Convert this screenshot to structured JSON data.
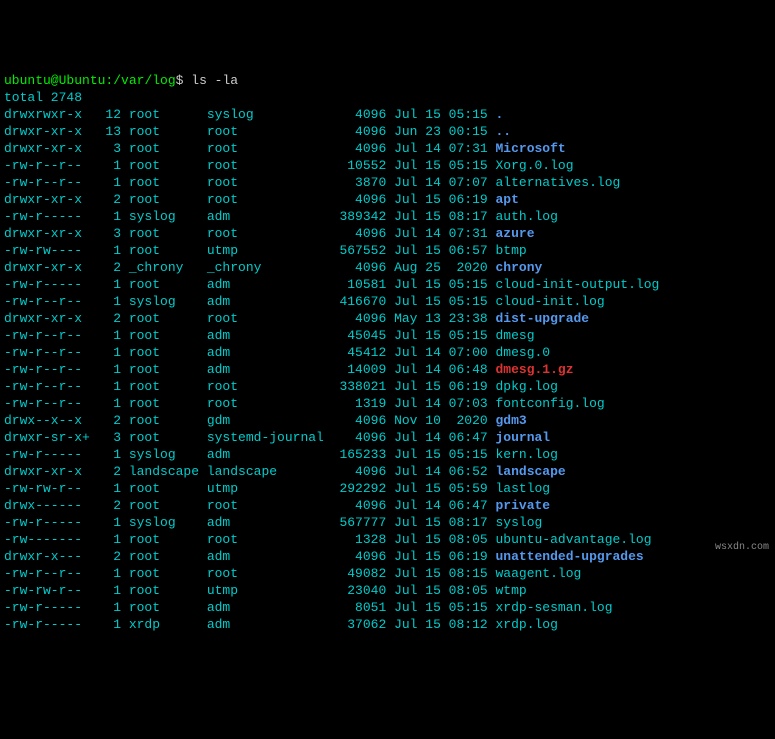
{
  "prompt": {
    "user_host": "ubuntu@Ubuntu",
    "sep": ":",
    "path": "/var/log",
    "dollar": "$",
    "command": "ls -la"
  },
  "total": "total 2748",
  "watermark": "wsxdn.com",
  "rows": [
    {
      "perm": "drwxrwxr-x",
      "links": "12",
      "owner": "root",
      "group": "syslog",
      "size": "4096",
      "date": "Jul 15 05:15",
      "name": ".",
      "cls": "dir"
    },
    {
      "perm": "drwxr-xr-x",
      "links": "13",
      "owner": "root",
      "group": "root",
      "size": "4096",
      "date": "Jun 23 00:15",
      "name": "..",
      "cls": "dir"
    },
    {
      "perm": "drwxr-xr-x",
      "links": "3",
      "owner": "root",
      "group": "root",
      "size": "4096",
      "date": "Jul 14 07:31",
      "name": "Microsoft",
      "cls": "dir"
    },
    {
      "perm": "-rw-r--r--",
      "links": "1",
      "owner": "root",
      "group": "root",
      "size": "10552",
      "date": "Jul 15 05:15",
      "name": "Xorg.0.log",
      "cls": "plain"
    },
    {
      "perm": "-rw-r--r--",
      "links": "1",
      "owner": "root",
      "group": "root",
      "size": "3870",
      "date": "Jul 14 07:07",
      "name": "alternatives.log",
      "cls": "plain"
    },
    {
      "perm": "drwxr-xr-x",
      "links": "2",
      "owner": "root",
      "group": "root",
      "size": "4096",
      "date": "Jul 15 06:19",
      "name": "apt",
      "cls": "dir"
    },
    {
      "perm": "-rw-r-----",
      "links": "1",
      "owner": "syslog",
      "group": "adm",
      "size": "389342",
      "date": "Jul 15 08:17",
      "name": "auth.log",
      "cls": "plain"
    },
    {
      "perm": "drwxr-xr-x",
      "links": "3",
      "owner": "root",
      "group": "root",
      "size": "4096",
      "date": "Jul 14 07:31",
      "name": "azure",
      "cls": "dir"
    },
    {
      "perm": "-rw-rw----",
      "links": "1",
      "owner": "root",
      "group": "utmp",
      "size": "567552",
      "date": "Jul 15 06:57",
      "name": "btmp",
      "cls": "plain"
    },
    {
      "perm": "drwxr-xr-x",
      "links": "2",
      "owner": "_chrony",
      "group": "_chrony",
      "size": "4096",
      "date": "Aug 25  2020",
      "name": "chrony",
      "cls": "dir"
    },
    {
      "perm": "-rw-r-----",
      "links": "1",
      "owner": "root",
      "group": "adm",
      "size": "10581",
      "date": "Jul 15 05:15",
      "name": "cloud-init-output.log",
      "cls": "plain"
    },
    {
      "perm": "-rw-r--r--",
      "links": "1",
      "owner": "syslog",
      "group": "adm",
      "size": "416670",
      "date": "Jul 15 05:15",
      "name": "cloud-init.log",
      "cls": "plain"
    },
    {
      "perm": "drwxr-xr-x",
      "links": "2",
      "owner": "root",
      "group": "root",
      "size": "4096",
      "date": "May 13 23:38",
      "name": "dist-upgrade",
      "cls": "dir"
    },
    {
      "perm": "-rw-r--r--",
      "links": "1",
      "owner": "root",
      "group": "adm",
      "size": "45045",
      "date": "Jul 15 05:15",
      "name": "dmesg",
      "cls": "plain"
    },
    {
      "perm": "-rw-r--r--",
      "links": "1",
      "owner": "root",
      "group": "adm",
      "size": "45412",
      "date": "Jul 14 07:00",
      "name": "dmesg.0",
      "cls": "plain"
    },
    {
      "perm": "-rw-r--r--",
      "links": "1",
      "owner": "root",
      "group": "adm",
      "size": "14009",
      "date": "Jul 14 06:48",
      "name": "dmesg.1.gz",
      "cls": "arc"
    },
    {
      "perm": "-rw-r--r--",
      "links": "1",
      "owner": "root",
      "group": "root",
      "size": "338021",
      "date": "Jul 15 06:19",
      "name": "dpkg.log",
      "cls": "plain"
    },
    {
      "perm": "-rw-r--r--",
      "links": "1",
      "owner": "root",
      "group": "root",
      "size": "1319",
      "date": "Jul 14 07:03",
      "name": "fontconfig.log",
      "cls": "plain"
    },
    {
      "perm": "drwx--x--x",
      "links": "2",
      "owner": "root",
      "group": "gdm",
      "size": "4096",
      "date": "Nov 10  2020",
      "name": "gdm3",
      "cls": "dir"
    },
    {
      "perm": "drwxr-sr-x+",
      "links": "3",
      "owner": "root",
      "group": "systemd-journal",
      "size": "4096",
      "date": "Jul 14 06:47",
      "name": "journal",
      "cls": "dir"
    },
    {
      "perm": "-rw-r-----",
      "links": "1",
      "owner": "syslog",
      "group": "adm",
      "size": "165233",
      "date": "Jul 15 05:15",
      "name": "kern.log",
      "cls": "plain"
    },
    {
      "perm": "drwxr-xr-x",
      "links": "2",
      "owner": "landscape",
      "group": "landscape",
      "size": "4096",
      "date": "Jul 14 06:52",
      "name": "landscape",
      "cls": "dir"
    },
    {
      "perm": "-rw-rw-r--",
      "links": "1",
      "owner": "root",
      "group": "utmp",
      "size": "292292",
      "date": "Jul 15 05:59",
      "name": "lastlog",
      "cls": "plain"
    },
    {
      "perm": "drwx------",
      "links": "2",
      "owner": "root",
      "group": "root",
      "size": "4096",
      "date": "Jul 14 06:47",
      "name": "private",
      "cls": "dir"
    },
    {
      "perm": "-rw-r-----",
      "links": "1",
      "owner": "syslog",
      "group": "adm",
      "size": "567777",
      "date": "Jul 15 08:17",
      "name": "syslog",
      "cls": "plain"
    },
    {
      "perm": "-rw-------",
      "links": "1",
      "owner": "root",
      "group": "root",
      "size": "1328",
      "date": "Jul 15 08:05",
      "name": "ubuntu-advantage.log",
      "cls": "plain"
    },
    {
      "perm": "drwxr-x---",
      "links": "2",
      "owner": "root",
      "group": "adm",
      "size": "4096",
      "date": "Jul 15 06:19",
      "name": "unattended-upgrades",
      "cls": "dir"
    },
    {
      "perm": "-rw-r--r--",
      "links": "1",
      "owner": "root",
      "group": "root",
      "size": "49082",
      "date": "Jul 15 08:15",
      "name": "waagent.log",
      "cls": "plain"
    },
    {
      "perm": "-rw-rw-r--",
      "links": "1",
      "owner": "root",
      "group": "utmp",
      "size": "23040",
      "date": "Jul 15 08:05",
      "name": "wtmp",
      "cls": "plain"
    },
    {
      "perm": "-rw-r-----",
      "links": "1",
      "owner": "root",
      "group": "adm",
      "size": "8051",
      "date": "Jul 15 05:15",
      "name": "xrdp-sesman.log",
      "cls": "plain"
    },
    {
      "perm": "-rw-r-----",
      "links": "1",
      "owner": "xrdp",
      "group": "adm",
      "size": "37062",
      "date": "Jul 15 08:12",
      "name": "xrdp.log",
      "cls": "plain"
    }
  ]
}
